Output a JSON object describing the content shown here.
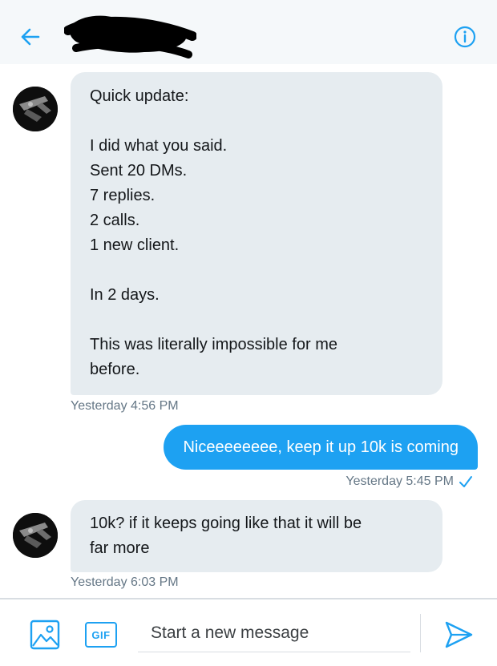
{
  "header": {
    "back_icon": "arrow-left-icon",
    "info_icon": "info-circle-icon",
    "accent_color": "#1da1f2"
  },
  "messages": [
    {
      "direction": "incoming",
      "lines": [
        "Quick update:",
        "",
        "I did what you said.",
        "Sent 20 DMs.",
        "7 replies.",
        "2 calls.",
        "1 new client.",
        "",
        "In 2 days.",
        "",
        "This was literally impossible for me",
        "before."
      ],
      "timestamp": "Yesterday 4:56 PM"
    },
    {
      "direction": "outgoing",
      "text": "Niceeeeeeee, keep it up 10k is coming",
      "timestamp": "Yesterday 5:45 PM",
      "status_icon": "read-check-icon"
    },
    {
      "direction": "incoming",
      "lines": [
        "10k? if it keeps going like that it will be",
        "far more"
      ],
      "timestamp": "Yesterday 6:03 PM"
    }
  ],
  "composer": {
    "image_icon": "image-icon",
    "gif_label": "GIF",
    "placeholder": "Start a new message",
    "value": "",
    "send_icon": "send-icon"
  },
  "colors": {
    "incoming_bubble": "#e6ecf0",
    "outgoing_bubble": "#1da1f2",
    "timestamp": "#657786",
    "header_bg": "#f5f8fa"
  }
}
